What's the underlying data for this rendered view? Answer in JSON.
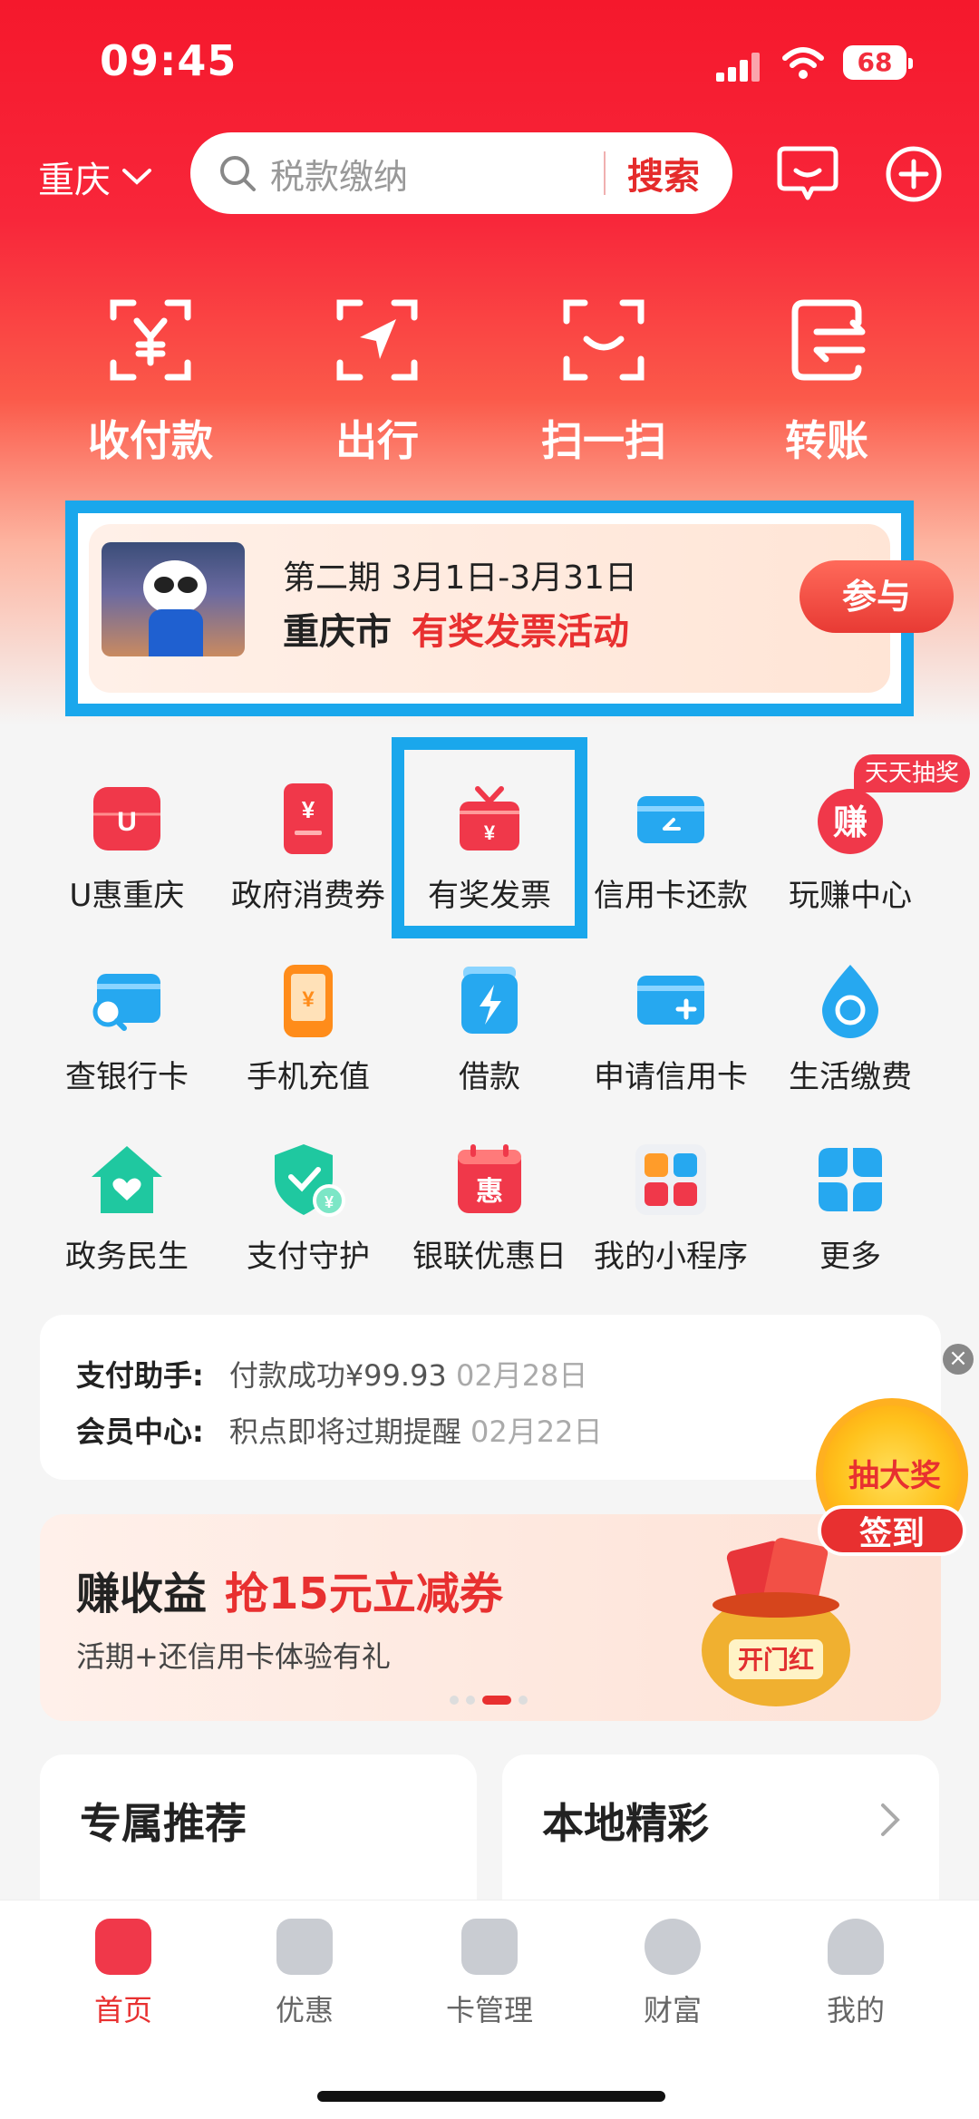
{
  "status_bar": {
    "time": "09:45",
    "battery": "68"
  },
  "header": {
    "city": "重庆",
    "search_placeholder": "税款缴纳",
    "search_button": "搜索"
  },
  "quick_actions": [
    {
      "label": "收付款",
      "icon": "yuan-scan-icon"
    },
    {
      "label": "出行",
      "icon": "navigation-icon"
    },
    {
      "label": "扫一扫",
      "icon": "scan-icon"
    },
    {
      "label": "转账",
      "icon": "transfer-icon"
    }
  ],
  "banner": {
    "line1": "第二期 3月1日-3月31日",
    "city": "重庆市",
    "title": "有奖发票活动",
    "button": "参与"
  },
  "services": [
    {
      "label": "U惠重庆",
      "icon": "u-hui-icon"
    },
    {
      "label": "政府消费券",
      "icon": "coupon-icon"
    },
    {
      "label": "有奖发票",
      "icon": "gift-invoice-icon"
    },
    {
      "label": "信用卡还款",
      "icon": "credit-card-repay-icon"
    },
    {
      "label": "玩赚中心",
      "icon": "earn-icon"
    },
    {
      "label": "查银行卡",
      "icon": "bank-card-search-icon"
    },
    {
      "label": "手机充值",
      "icon": "phone-recharge-icon"
    },
    {
      "label": "借款",
      "icon": "loan-icon"
    },
    {
      "label": "申请信用卡",
      "icon": "apply-card-icon"
    },
    {
      "label": "生活缴费",
      "icon": "utility-icon"
    },
    {
      "label": "政务民生",
      "icon": "gov-house-icon"
    },
    {
      "label": "支付守护",
      "icon": "shield-icon"
    },
    {
      "label": "银联优惠日",
      "icon": "calendar-icon"
    },
    {
      "label": "我的小程序",
      "icon": "mini-programs-icon"
    },
    {
      "label": "更多",
      "icon": "more-icon"
    }
  ],
  "service_tag": "天天抽奖",
  "assistant": {
    "rows": [
      {
        "key": "支付助手:",
        "value": "付款成功¥99.93",
        "date": "02月28日"
      },
      {
        "key": "会员中心:",
        "value": "积点即将过期提醒",
        "date": "02月22日"
      }
    ]
  },
  "floating": {
    "wheel_text": "抽大奖",
    "sign": "签到"
  },
  "promo": {
    "title": "赚收益",
    "highlight": "抢15元立减券",
    "subtitle": "活期+还信用卡体验有礼",
    "pot_text": "开门红"
  },
  "cards": {
    "left_title": "专属推荐",
    "right_title": "本地精彩"
  },
  "tabs": [
    {
      "label": "首页",
      "icon": "home-icon",
      "active": true
    },
    {
      "label": "优惠",
      "icon": "discount-icon",
      "active": false
    },
    {
      "label": "卡管理",
      "icon": "card-manage-icon",
      "active": false
    },
    {
      "label": "财富",
      "icon": "wealth-icon",
      "active": false
    },
    {
      "label": "我的",
      "icon": "profile-icon",
      "active": false
    }
  ],
  "colors": {
    "brand_red": "#e83030",
    "highlight_blue": "#1aa7ec"
  }
}
